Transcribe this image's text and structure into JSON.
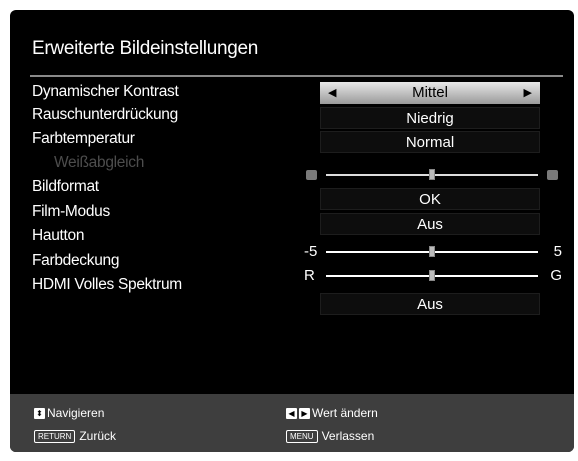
{
  "title": "Erweiterte Bildeinstellungen",
  "settings": [
    {
      "label": "Dynamischer Kontrast",
      "value": "Mittel"
    },
    {
      "label": "Rauschunterdrückung",
      "value": "Niedrig"
    },
    {
      "label": "Farbtemperatur",
      "value": "Normal"
    },
    {
      "label": "Weißabgleich"
    },
    {
      "label": "Bildformat",
      "value": "OK"
    },
    {
      "label": "Film-Modus",
      "value": "Aus"
    },
    {
      "label": "Hautton",
      "min_label": "-5",
      "max_label": "5"
    },
    {
      "label": "Farbdeckung",
      "min_label": "R",
      "max_label": "G"
    },
    {
      "label": "HDMI Volles Spektrum",
      "value": "Aus"
    }
  ],
  "footer": {
    "nav": "Navigieren",
    "change": "Wert ändern",
    "return_key": "RETURN",
    "back": "Zurück",
    "menu_key": "MENU",
    "exit": "Verlassen"
  },
  "colors": {
    "menu_bg": "#000000",
    "footer_bg": "#3e3e3e",
    "disabled_text": "#4d4d4d"
  }
}
